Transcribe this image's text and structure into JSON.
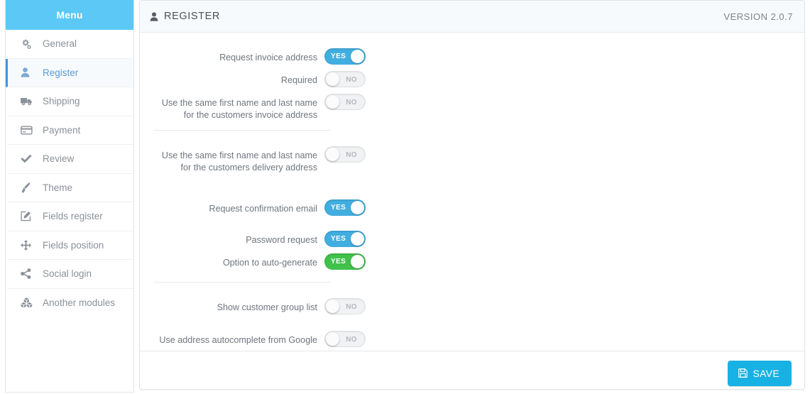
{
  "sidebar": {
    "header": "Menu",
    "items": [
      {
        "label": "General",
        "icon": "gears-icon",
        "active": false
      },
      {
        "label": "Register",
        "icon": "user-icon",
        "active": true
      },
      {
        "label": "Shipping",
        "icon": "truck-icon",
        "active": false
      },
      {
        "label": "Payment",
        "icon": "credit-card-icon",
        "active": false
      },
      {
        "label": "Review",
        "icon": "check-icon",
        "active": false
      },
      {
        "label": "Theme",
        "icon": "paintbrush-icon",
        "active": false
      },
      {
        "label": "Fields register",
        "icon": "edit-square-icon",
        "active": false
      },
      {
        "label": "Fields position",
        "icon": "arrows-move-icon",
        "active": false
      },
      {
        "label": "Social login",
        "icon": "share-icon",
        "active": false
      },
      {
        "label": "Another modules",
        "icon": "cubes-icon",
        "active": false
      }
    ]
  },
  "panel": {
    "title": "REGISTER",
    "title_icon": "user-icon",
    "version": "VERSION 2.0.7"
  },
  "form": {
    "rows": [
      {
        "label": "Request invoice address",
        "state": "YES",
        "on": true,
        "color": "blue"
      },
      {
        "label": "Required",
        "state": "NO",
        "on": false,
        "color": "grey"
      },
      {
        "label": "Use the same first name and last name\nfor the customers invoice address",
        "state": "NO",
        "on": false,
        "color": "grey"
      },
      {
        "label": "Use the same first name and last name\nfor the customers delivery address",
        "state": "NO",
        "on": false,
        "color": "grey"
      },
      {
        "label": "Request confirmation email",
        "state": "YES",
        "on": true,
        "color": "blue"
      },
      {
        "label": "Password request",
        "state": "YES",
        "on": true,
        "color": "blue"
      },
      {
        "label": "Option to auto-generate",
        "state": "YES",
        "on": true,
        "color": "green"
      },
      {
        "label": "Show customer group list",
        "state": "NO",
        "on": false,
        "color": "grey"
      },
      {
        "label": "Use address autocomplete from Google",
        "state": "NO",
        "on": false,
        "color": "grey"
      }
    ]
  },
  "footer": {
    "save_label": "SAVE",
    "save_icon": "floppy-disk-icon"
  },
  "colors": {
    "menu_header": "#5bc8f5",
    "toggle_on": "#41aee0",
    "toggle_on_green": "#3fc14a",
    "toggle_off": "#f1f2f3",
    "save_button": "#18b1e4",
    "active_item_border": "#4a90d9"
  }
}
